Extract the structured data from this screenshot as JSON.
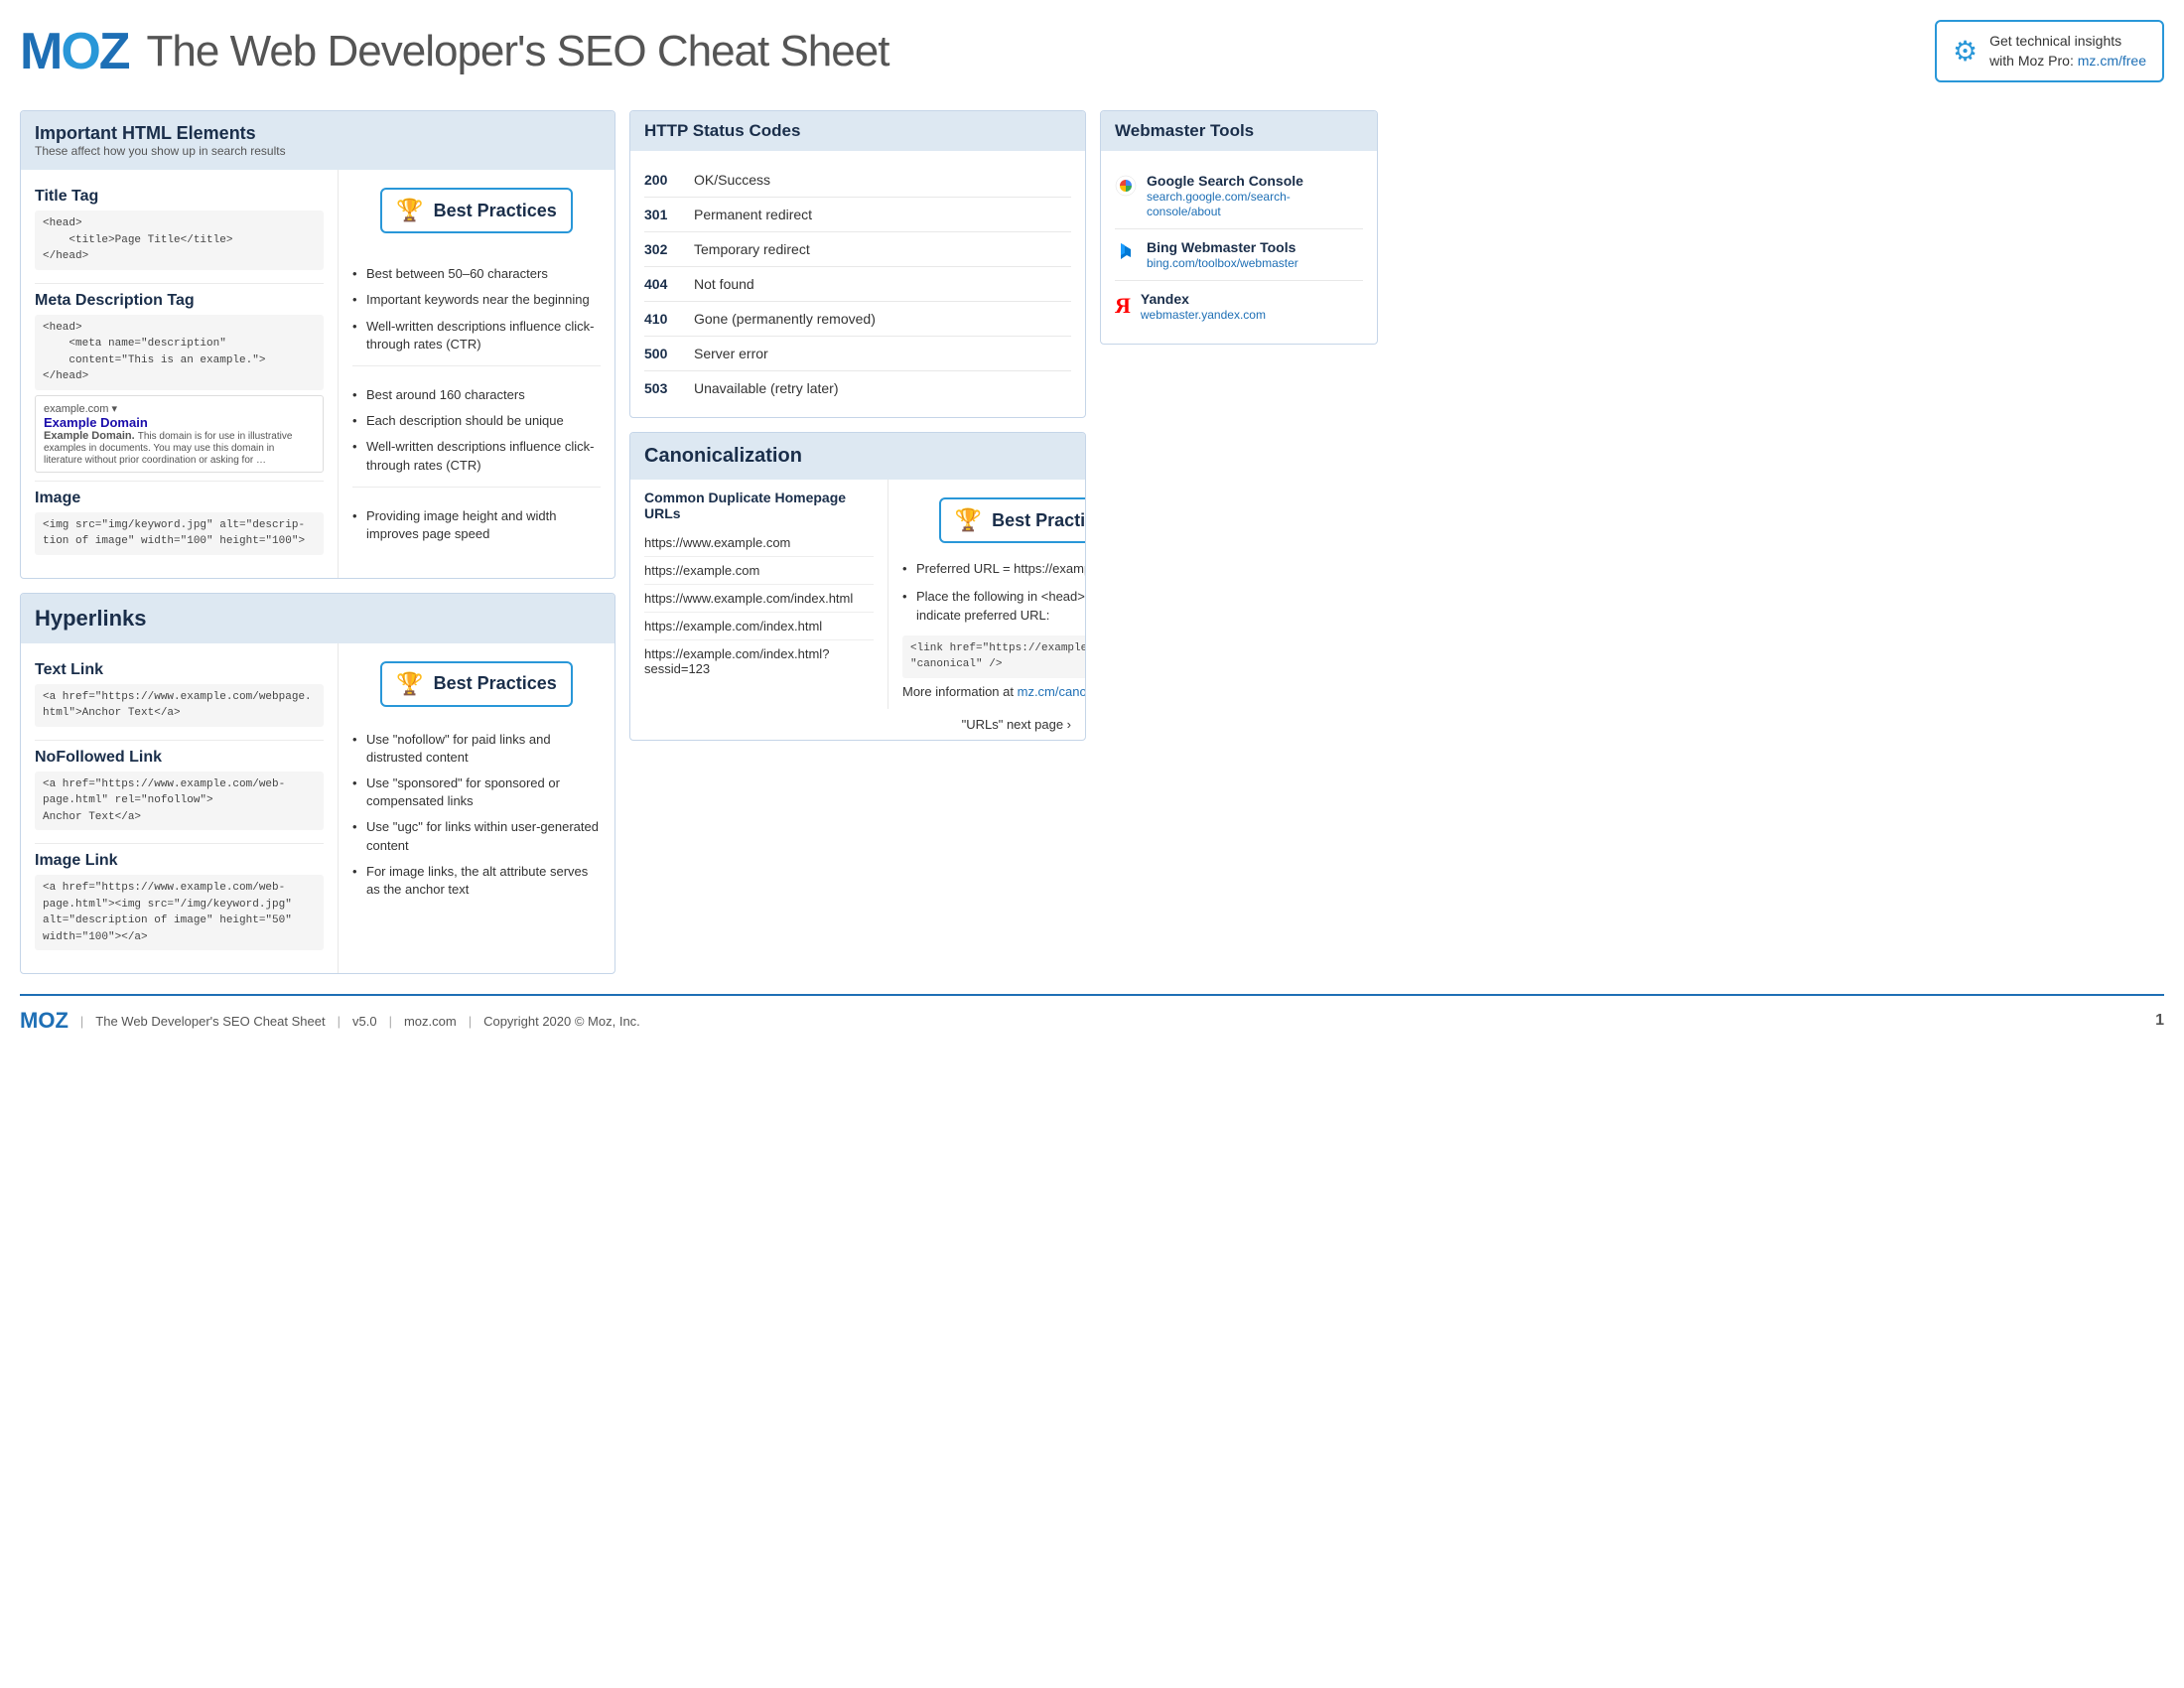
{
  "header": {
    "logo": "MOZ",
    "title": "The Web Developer's SEO Cheat Sheet",
    "promo_text": "Get technical insights",
    "promo_text2": "with Moz Pro:",
    "promo_link": "mz.cm/free",
    "promo_icon": "⚙"
  },
  "html_elements": {
    "panel_title": "Important HTML Elements",
    "panel_subtitle": "These affect how you show up in search results",
    "best_practices_label": "Best Practices",
    "items": [
      {
        "title": "Title Tag",
        "code": "<head>\n    <title>Page Title</title>\n</head>",
        "practices": [
          "Best between 50–60 characters",
          "Important keywords near the beginning",
          "Well-written descriptions influence click-through rates (CTR)"
        ]
      },
      {
        "title": "Meta Description Tag",
        "code": "<head>\n    <meta name=\"description\"\n    content=\"This is an example.\">\n</head>",
        "search_preview": {
          "domain": "example.com ▾",
          "title": "Example Domain",
          "desc_bold": "Example Domain.",
          "desc": " This domain is for use in illustrative examples in documents. You may use this domain in literature without prior coordination or asking for …"
        },
        "practices": [
          "Best around 160 characters",
          "Each description should be unique",
          "Well-written descriptions influence click-through rates (CTR)"
        ]
      },
      {
        "title": "Image",
        "code": "<img src=\"img/keyword.jpg\" alt=\"descrip-\ntion of image\" width=\"100\" height=\"100\">",
        "practices": [
          "Providing image height and width improves page speed"
        ]
      }
    ]
  },
  "hyperlinks": {
    "panel_title": "Hyperlinks",
    "best_practices_label": "Best Practices",
    "items": [
      {
        "title": "Text Link",
        "code": "<a href=\"https://www.example.com/webpage.\nhtml\">Anchor Text</a>"
      },
      {
        "title": "NoFollowed Link",
        "code": "<a href=\"https://www.example.com/web-\npage.html\" rel=\"nofollow\">\nAnchor Text</a>"
      },
      {
        "title": "Image Link",
        "code": "<a href=\"https://www.example.com/web-\npage.html\"><img src=\"/img/keyword.jpg\"\nalt=\"description of image\" height=\"50\"\nwidth=\"100\"></a>"
      }
    ],
    "practices": [
      "Use \"nofollow\" for paid links and distrusted content",
      "Use \"sponsored\" for sponsored or compensated links",
      "Use \"ugc\" for links within user-generated content",
      "For image links, the alt attribute serves as the anchor text"
    ]
  },
  "http_status": {
    "panel_title": "HTTP Status Codes",
    "items": [
      {
        "code": "200",
        "desc": "OK/Success"
      },
      {
        "code": "301",
        "desc": "Permanent redirect"
      },
      {
        "code": "302",
        "desc": "Temporary redirect"
      },
      {
        "code": "404",
        "desc": "Not found"
      },
      {
        "code": "410",
        "desc": "Gone (permanently removed)"
      },
      {
        "code": "500",
        "desc": "Server error"
      },
      {
        "code": "503",
        "desc": "Unavailable (retry later)"
      }
    ]
  },
  "webmaster_tools": {
    "panel_title": "Webmaster Tools",
    "items": [
      {
        "name": "Google Search Console",
        "link": "search.google.com/search-console/about",
        "icon": "G"
      },
      {
        "name": "Bing Webmaster Tools",
        "link": "bing.com/toolbox/webmaster",
        "icon": "B"
      },
      {
        "name": "Yandex",
        "link": "webmaster.yandex.com",
        "icon": "Y"
      }
    ]
  },
  "canonicalization": {
    "panel_title": "Canonicalization",
    "best_practices_label": "Best Practices",
    "duplicate_title": "Common Duplicate Homepage URLs",
    "urls": [
      "https://www.example.com",
      "https://example.com",
      "https://www.example.com/index.html",
      "https://example.com/index.html",
      "https://example.com/index.html?sessid=123"
    ],
    "practices": [
      "Preferred URL = https://example.com/",
      "Place the following in <head> section to indicate preferred URL:",
      "<link href=\"https://example.com/\" rel=\n\"canonical\" />",
      "More information at mz.cm/canonical"
    ],
    "canon_link": "mz.cm/canonical"
  },
  "footer": {
    "logo": "MOZ",
    "text": "The Web Developer's SEO Cheat Sheet",
    "version": "v5.0",
    "domain": "moz.com",
    "copyright": "Copyright 2020 © Moz, Inc.",
    "page": "1"
  },
  "next_page": "\"URLs\" next page ›"
}
